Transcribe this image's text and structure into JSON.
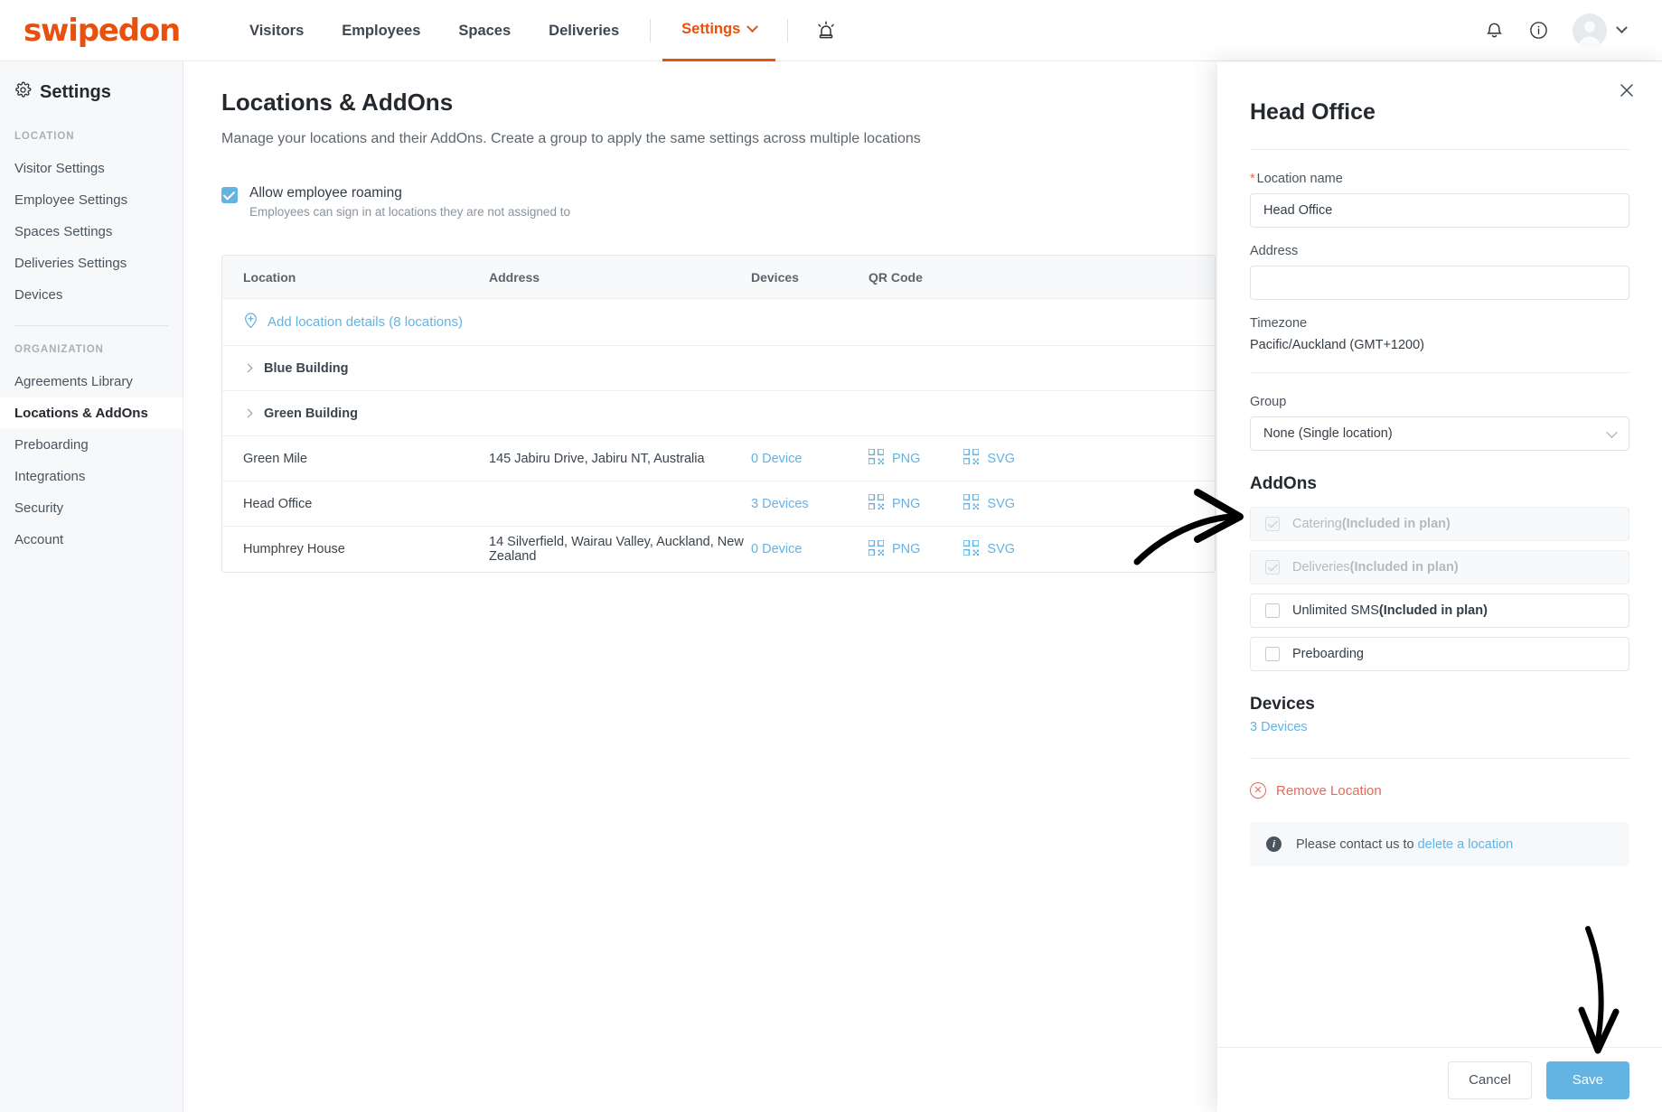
{
  "nav": {
    "brand": "swipedon",
    "links": [
      {
        "label": "Visitors",
        "active": false
      },
      {
        "label": "Employees",
        "active": false
      },
      {
        "label": "Spaces",
        "active": false
      },
      {
        "label": "Deliveries",
        "active": false
      },
      {
        "label": "Settings",
        "active": true
      }
    ],
    "beacon_icon": "alarm-beacon-icon",
    "bell_icon": "notifications-bell-icon",
    "info_icon": "info-circle-icon",
    "avatar_icon": "user-avatar-icon",
    "accent_color": "#e8500e"
  },
  "sidebar": {
    "title": "Settings",
    "gear_icon": "gear-icon",
    "groups": [
      {
        "label": "LOCATION",
        "items": [
          {
            "label": "Visitor Settings",
            "active": false
          },
          {
            "label": "Employee Settings",
            "active": false
          },
          {
            "label": "Spaces Settings",
            "active": false
          },
          {
            "label": "Deliveries Settings",
            "active": false
          },
          {
            "label": "Devices",
            "active": false
          }
        ]
      },
      {
        "label": "ORGANIZATION",
        "items": [
          {
            "label": "Agreements Library",
            "active": false
          },
          {
            "label": "Locations & AddOns",
            "active": true
          },
          {
            "label": "Preboarding",
            "active": false
          },
          {
            "label": "Integrations",
            "active": false
          },
          {
            "label": "Security",
            "active": false
          },
          {
            "label": "Account",
            "active": false
          }
        ]
      }
    ]
  },
  "main": {
    "title": "Locations & AddOns",
    "subtitle": "Manage your locations and their AddOns. Create a group to apply the same settings across multiple locations",
    "roaming": {
      "checked": true,
      "label": "Allow employee roaming",
      "description": "Employees can sign in at locations they are not assigned to"
    },
    "table": {
      "columns": [
        "Location",
        "Address",
        "Devices",
        "QR Code"
      ],
      "add_row_label": "Add location details (8 locations)",
      "groups": [
        {
          "name": "Blue Building"
        },
        {
          "name": "Green Building"
        }
      ],
      "rows": [
        {
          "location": "Green Mile",
          "address": "145 Jabiru Drive, Jabiru NT, Australia",
          "devices": "0 Device",
          "qr": [
            "PNG",
            "SVG"
          ]
        },
        {
          "location": "Head Office",
          "address": "",
          "devices": "3 Devices",
          "qr": [
            "PNG",
            "SVG"
          ]
        },
        {
          "location": "Humphrey House",
          "address": "14 Silverfield, Wairau Valley, Auckland, New Zealand",
          "devices": "0 Device",
          "qr": [
            "PNG",
            "SVG"
          ]
        }
      ]
    }
  },
  "panel": {
    "title": "Head Office",
    "close_icon": "close-icon",
    "location_name": {
      "label": "Location name",
      "required_marker": "*",
      "value": "Head Office"
    },
    "address": {
      "label": "Address",
      "value": "",
      "placeholder": ""
    },
    "timezone": {
      "label": "Timezone",
      "value": "Pacific/Auckland (GMT+1200)"
    },
    "group": {
      "label": "Group",
      "value": "None (Single location)"
    },
    "addons": {
      "title": "AddOns",
      "items": [
        {
          "label": "Catering ",
          "suffix": "(Included in plan)",
          "checked": true,
          "disabled": true
        },
        {
          "label": "Deliveries ",
          "suffix": "(Included in plan)",
          "checked": true,
          "disabled": true
        },
        {
          "label": "Unlimited SMS ",
          "suffix": "(Included in plan)",
          "checked": false,
          "disabled": false
        },
        {
          "label": "Preboarding",
          "suffix": "",
          "checked": false,
          "disabled": false
        }
      ]
    },
    "devices": {
      "title": "Devices",
      "link": "3 Devices"
    },
    "remove": {
      "label": "Remove Location",
      "icon": "remove-circle-icon"
    },
    "info": {
      "icon": "info-icon",
      "text": "Please contact us to ",
      "link": "delete a location"
    },
    "footer": {
      "cancel": "Cancel",
      "save": "Save"
    },
    "save_color": "#63b3e3"
  }
}
